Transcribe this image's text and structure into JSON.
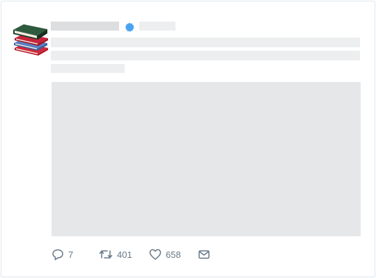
{
  "tweet": {
    "stats": {
      "replies": "7",
      "retweets": "401",
      "likes": "658"
    }
  },
  "icons": {
    "avatar": "books-icon",
    "verified": "verified-badge-icon",
    "reply": "reply-icon",
    "retweet": "retweet-icon",
    "like": "heart-icon",
    "message": "envelope-icon"
  },
  "colors": {
    "verified": "#4aa3f0",
    "action": "#657786",
    "placeholder": "#e6e8ea",
    "border": "#e1e8ed"
  }
}
